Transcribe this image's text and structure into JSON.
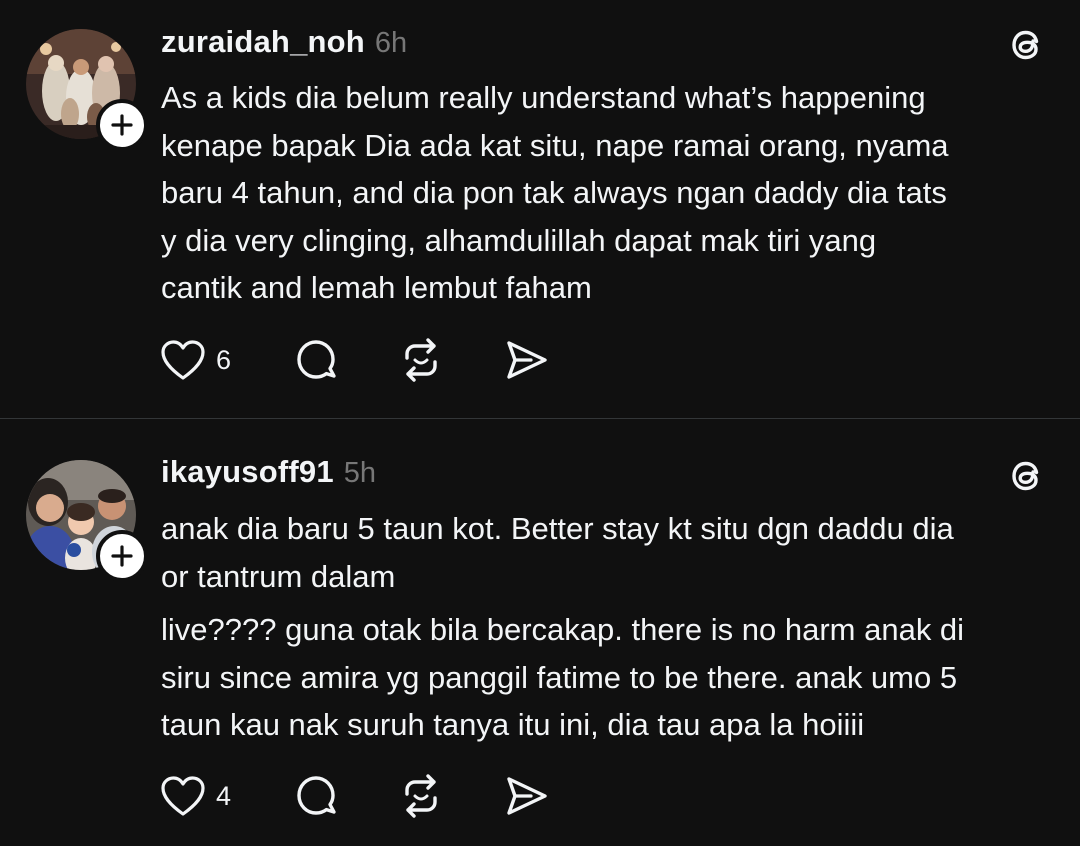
{
  "posts": [
    {
      "username": "zuraidah_noh",
      "time": "6h",
      "body_lines": [
        "As a kids dia belum really understand what’s happening",
        "kenape bapak Dia ada kat situ, nape ramai orang, nyama",
        "baru 4 tahun, and dia pon tak always ngan daddy dia tats",
        "y dia very clinging, alhamdulillah dapat mak tiri yang",
        "cantik and lemah lembut faham"
      ],
      "likes": "6",
      "avatar_icon": "group-photo-avatar",
      "follow_icon": "plus-icon"
    },
    {
      "username": "ikayusoff91",
      "time": "5h",
      "body_lines_1": [
        "anak dia baru 5 taun kot. Better stay kt situ dgn daddu dia",
        "or tantrum dalam"
      ],
      "body_lines_2": [
        "live???? guna otak bila bercakap. there is no harm anak di",
        "siru since amira yg panggil fatime to be there. anak umo 5",
        "taun kau nak suruh tanya itu ini, dia tau apa la hoiiii"
      ],
      "likes": "4",
      "avatar_icon": "family-selfie-avatar",
      "follow_icon": "plus-icon"
    }
  ],
  "colors": {
    "background": "#101010",
    "text": "#f3f5f7",
    "muted": "#777777",
    "divider": "#333638"
  },
  "icons": {
    "brand": "threads-logo-icon",
    "like": "heart-icon",
    "comment": "comment-bubble-icon",
    "repost": "repost-icon",
    "share": "send-icon"
  }
}
